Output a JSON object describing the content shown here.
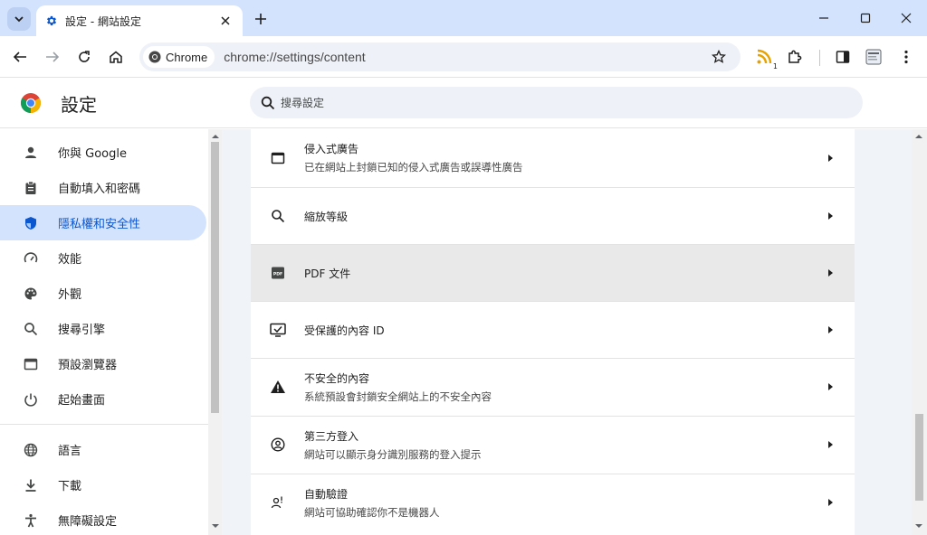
{
  "window": {
    "tab_title": "設定 - 網站設定",
    "colors": {
      "frame": "#d3e3fd",
      "accent": "#0b57d0",
      "active_item_bg": "#d3e3fd"
    }
  },
  "toolbar": {
    "chip_label": "Chrome",
    "url": "chrome://settings/content",
    "extension_badge": "1"
  },
  "header": {
    "title": "設定",
    "search_placeholder": "搜尋設定"
  },
  "sidebar": {
    "items": [
      {
        "label": "你與 Google",
        "icon": "person-icon"
      },
      {
        "label": "自動填入和密碼",
        "icon": "clipboard-icon"
      },
      {
        "label": "隱私權和安全性",
        "icon": "shield-icon",
        "active": true
      },
      {
        "label": "效能",
        "icon": "speedometer-icon"
      },
      {
        "label": "外觀",
        "icon": "palette-icon"
      },
      {
        "label": "搜尋引擎",
        "icon": "search-icon"
      },
      {
        "label": "預設瀏覽器",
        "icon": "browser-icon"
      },
      {
        "label": "起始畫面",
        "icon": "power-icon"
      },
      {
        "label": "語言",
        "icon": "globe-icon"
      },
      {
        "label": "下載",
        "icon": "download-icon"
      },
      {
        "label": "無障礙設定",
        "icon": "accessibility-icon"
      }
    ]
  },
  "content": {
    "rows": [
      {
        "title": "侵入式廣告",
        "subtitle": "已在網站上封鎖已知的侵入式廣告或誤導性廣告",
        "icon": "window-icon"
      },
      {
        "title": "縮放等級",
        "subtitle": "",
        "icon": "zoom-icon"
      },
      {
        "title": "PDF 文件",
        "subtitle": "",
        "icon": "pdf-icon"
      },
      {
        "title": "受保護的內容 ID",
        "subtitle": "",
        "icon": "protected-content-icon"
      },
      {
        "title": "不安全的內容",
        "subtitle": "系統預設會封鎖安全網站上的不安全內容",
        "icon": "warning-icon"
      },
      {
        "title": "第三方登入",
        "subtitle": "網站可以顯示身分識別服務的登入提示",
        "icon": "account-circle-icon"
      },
      {
        "title": "自動驗證",
        "subtitle": "網站可協助確認你不是機器人",
        "icon": "person-verify-icon"
      }
    ]
  }
}
